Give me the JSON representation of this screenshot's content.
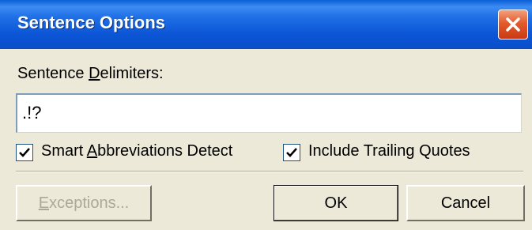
{
  "window": {
    "title": "Sentence Options",
    "close_icon": "close-icon"
  },
  "form": {
    "delimiters_label_before": "Sentence ",
    "delimiters_label_underlined": "D",
    "delimiters_label_after": "elimiters:",
    "delimiters_value": ".!?",
    "smart_abbrev": {
      "checked": true,
      "label_before": "Smart ",
      "label_underlined": "A",
      "label_after": "bbreviations Detect"
    },
    "trailing_quotes": {
      "checked": true,
      "label": "Include Trailing Quotes"
    }
  },
  "buttons": {
    "exceptions_before": "",
    "exceptions_underlined": "E",
    "exceptions_after": "xceptions...",
    "ok": "OK",
    "cancel": "Cancel"
  },
  "colors": {
    "title_bar": "#0a55d6",
    "window_bg": "#ece9d8",
    "close_button": "#e35b2d"
  }
}
